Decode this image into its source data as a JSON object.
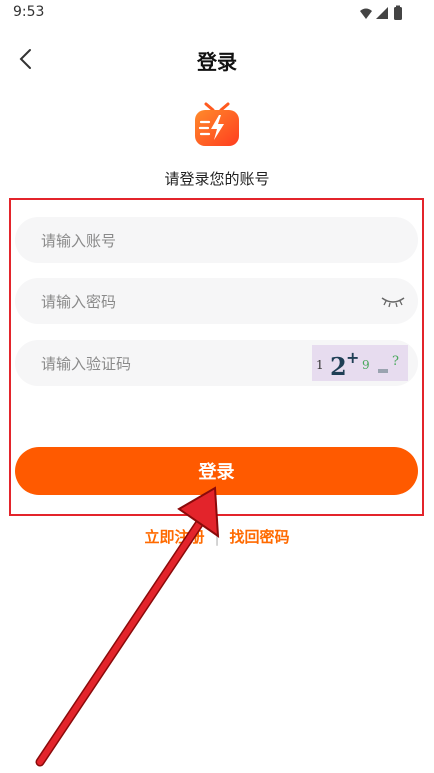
{
  "status_bar": {
    "time": "9:53"
  },
  "header": {
    "title": "登录"
  },
  "subtitle": "请登录您的账号",
  "form": {
    "account_placeholder": "请输入账号",
    "password_placeholder": "请输入密码",
    "captcha_placeholder": "请输入验证码",
    "login_label": "登录"
  },
  "links": {
    "register": "立即注册",
    "separator": "|",
    "forgot": "找回密码"
  },
  "colors": {
    "accent": "#ff5a00",
    "highlight": "#e3242b",
    "field_bg": "#f6f6f7"
  },
  "icons": [
    "back-icon",
    "app-logo-icon",
    "eye-closed-icon",
    "captcha-image",
    "wifi-icon",
    "signal-icon",
    "battery-icon"
  ]
}
